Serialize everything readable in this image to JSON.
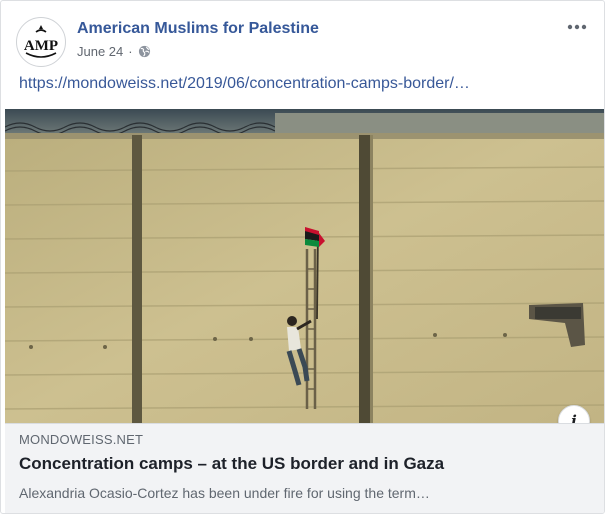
{
  "post": {
    "author": "American Muslims for Palestine",
    "avatar_text": "AMP",
    "date": "June 24",
    "privacy_icon": "globe-icon",
    "more_icon": "ellipsis-icon",
    "link_url": "https://mondoweiss.net/2019/06/concentration-camps-border/…"
  },
  "preview": {
    "domain": "MONDOWEISS.NET",
    "headline": "Concentration camps – at the US border and in Gaza",
    "description": "Alexandria Ocasio-Cortez has been under fire for using the term…",
    "info_icon": "i"
  },
  "colors": {
    "link_blue": "#365899",
    "meta_gray": "#616770",
    "preview_bg": "#f2f3f5",
    "flag_green": "#0b8a3c",
    "flag_red": "#c8102e"
  }
}
